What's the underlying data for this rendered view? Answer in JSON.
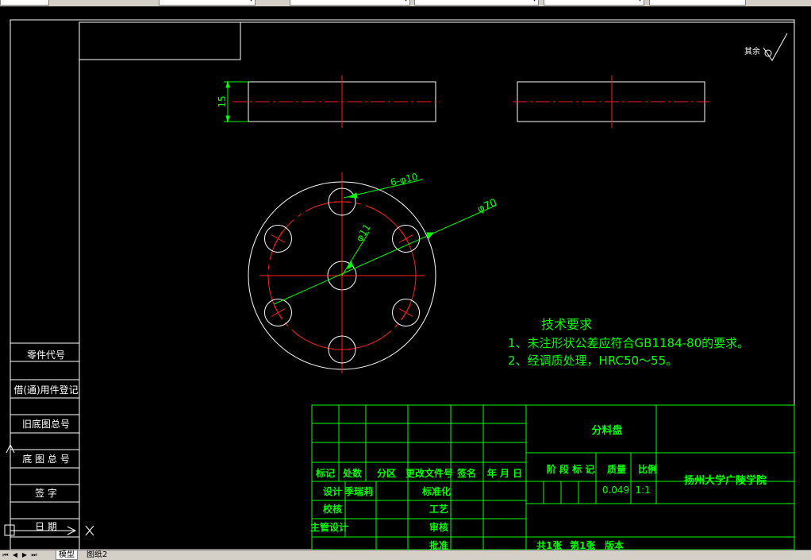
{
  "colors": {
    "background": "#000000",
    "outline": "#ffffff",
    "centerline": "#ff2020",
    "dimension": "#00ff00",
    "title_block": "#00ff00",
    "notes": "#00ff00"
  },
  "toolbar": {
    "dropdown_arrow": "▾"
  },
  "drawing": {
    "roughness_label": "其余",
    "dim_thickness": "15",
    "dim_holes": "6-φ10",
    "dim_outer": "φ70",
    "dim_center": "φ11",
    "tech_title": "技术要求",
    "tech_line1": "1、未注形状公差应符合GB1184-80的要求。",
    "tech_line2": "2、经调质处理，HRC50～55。"
  },
  "side_column": {
    "items": [
      "零件代号",
      "借(通)用件登记",
      "旧底图总号",
      "底 图 总 号",
      "签   字",
      "日   期"
    ]
  },
  "title_block": {
    "part_name": "分料盘",
    "school": "扬州大学广陵学院",
    "header_labels": [
      "标记",
      "处数",
      "分区",
      "更改文件号",
      "签名",
      "年 月 日"
    ],
    "design_label": "设计",
    "designer": "季瑞莉",
    "standard_label": "标准化",
    "check_label": "校核",
    "process_label": "工艺",
    "chief_label": "主管设计",
    "review_label": "审核",
    "approve_label": "批准",
    "stage_label": "阶 段 标 记",
    "mass_label": "质量",
    "scale_label": "比例",
    "mass_value": "0.049",
    "scale_value": "1:1",
    "sheets_total": "共1张",
    "sheet_no": "第1张",
    "version": "版本"
  },
  "tabs": {
    "model": "模型",
    "layout": "图纸2"
  }
}
